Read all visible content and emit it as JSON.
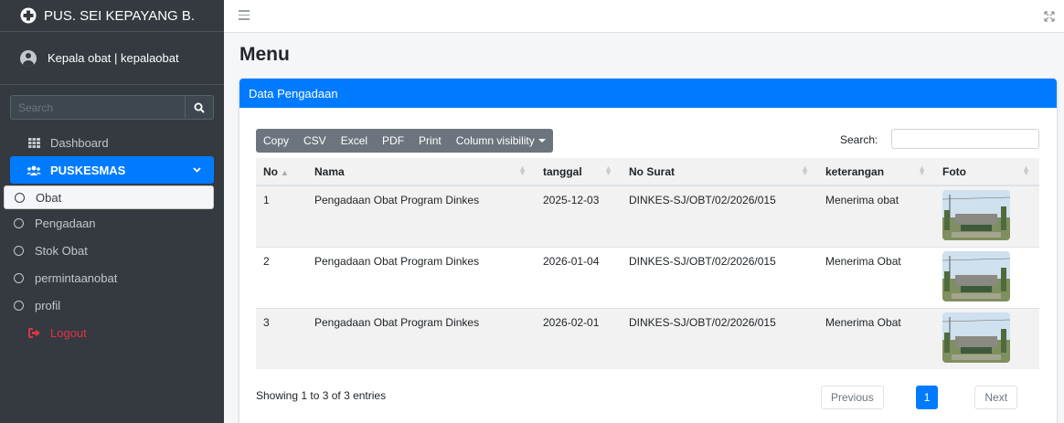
{
  "brand": {
    "name": "PUS. SEI KEPAYANG B."
  },
  "user": {
    "name": "Kepala obat | kepalaobat"
  },
  "sidebar_search": {
    "placeholder": "Search"
  },
  "nav": {
    "dashboard": "Dashboard",
    "puskesmas": "PUSKESMAS",
    "obat": "Obat",
    "pengadaan": "Pengadaan",
    "stok_obat": "Stok Obat",
    "permintaanobat": "permintaanobat",
    "profil": "profil",
    "logout": "Logout"
  },
  "page": {
    "title": "Menu"
  },
  "card": {
    "header": "Data Pengadaan"
  },
  "buttons": {
    "copy": "Copy",
    "csv": "CSV",
    "excel": "Excel",
    "pdf": "PDF",
    "print": "Print",
    "column_visibility": "Column visibility"
  },
  "search": {
    "label": "Search:",
    "value": ""
  },
  "table": {
    "headers": [
      "No",
      "Nama",
      "tanggal",
      "No Surat",
      "keterangan",
      "Foto"
    ],
    "rows": [
      {
        "no": "1",
        "nama": "Pengadaan Obat Program Dinkes",
        "tanggal": "2025-12-03",
        "no_surat": "DINKES-SJ/OBT/02/2026/015",
        "keterangan": "Menerima obat"
      },
      {
        "no": "2",
        "nama": "Pengadaan Obat Program Dinkes",
        "tanggal": "2026-01-04",
        "no_surat": "DINKES-SJ/OBT/02/2026/015",
        "keterangan": "Menerima Obat"
      },
      {
        "no": "3",
        "nama": "Pengadaan Obat Program Dinkes",
        "tanggal": "2026-02-01",
        "no_surat": "DINKES-SJ/OBT/02/2026/015",
        "keterangan": "Menerima Obat"
      }
    ]
  },
  "footer": {
    "info": "Showing 1 to 3 of 3 entries",
    "previous": "Previous",
    "page": "1",
    "next": "Next"
  },
  "colors": {
    "primary": "#007bff",
    "sidebar": "#343a40",
    "logout": "#dc3545",
    "button_group": "#6c757d"
  }
}
